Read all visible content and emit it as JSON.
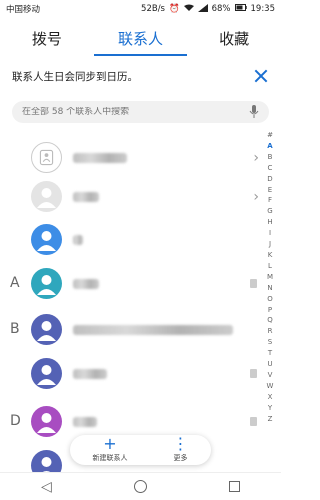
{
  "status_bar": {
    "carrier": "中国移动",
    "net_speed": "52B/s",
    "battery": "68%",
    "time": "19:35"
  },
  "tabs": [
    {
      "label": "拨号",
      "active": false
    },
    {
      "label": "联系人",
      "active": true
    },
    {
      "label": "收藏",
      "active": false
    }
  ],
  "banner": {
    "text": "联系人生日会同步到日历。"
  },
  "search": {
    "placeholder": "在全部 58 个联系人中搜索"
  },
  "index_letters": [
    "#",
    "A",
    "B",
    "C",
    "D",
    "E",
    "F",
    "G",
    "H",
    "I",
    "J",
    "K",
    "L",
    "M",
    "N",
    "O",
    "P",
    "Q",
    "R",
    "S",
    "T",
    "U",
    "V",
    "W",
    "X",
    "Y",
    "Z"
  ],
  "index_active": "A",
  "contacts": [
    {
      "section": "",
      "avatar": "card",
      "name": "",
      "trail": "chevron"
    },
    {
      "section": "",
      "avatar": "gray",
      "name": "",
      "trail": "chevron"
    },
    {
      "section": "",
      "avatar": "blue",
      "name": "",
      "trail": ""
    },
    {
      "section": "A",
      "avatar": "teal",
      "name": "",
      "trail": "badge"
    },
    {
      "section": "B",
      "avatar": "indigo",
      "name": "",
      "trail": ""
    },
    {
      "section": "",
      "avatar": "indigo",
      "name": "",
      "trail": "badge"
    },
    {
      "section": "D",
      "avatar": "purple",
      "name": "",
      "trail": "badge"
    },
    {
      "section": "",
      "avatar": "indigo",
      "name": "",
      "trail": ""
    }
  ],
  "fab": {
    "new_contact": "新建联系人",
    "more": "更多"
  },
  "colors": {
    "accent": "#1a6fd1"
  }
}
